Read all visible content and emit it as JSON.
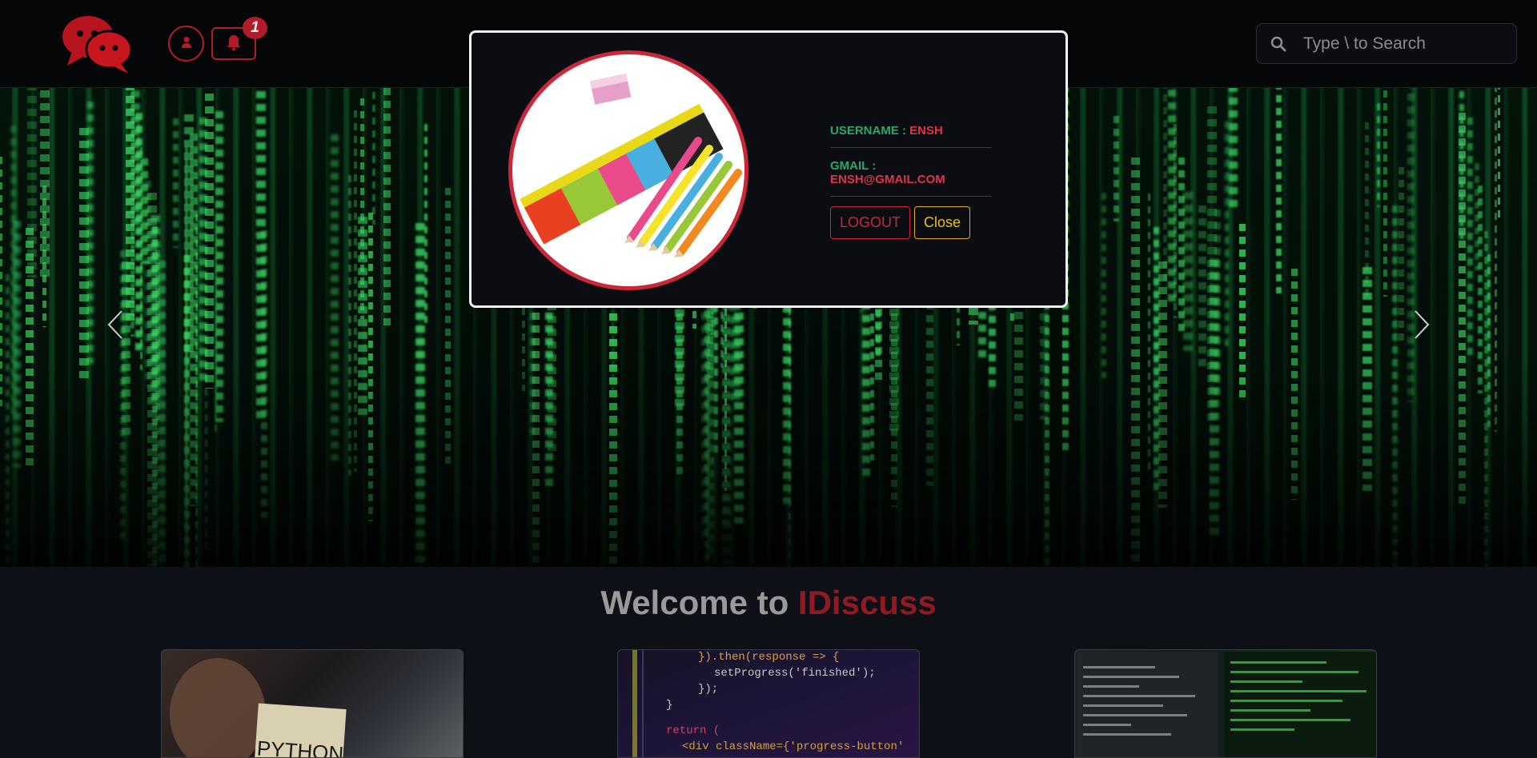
{
  "navbar": {
    "notification_count": "1",
    "search_placeholder": "Type \\ to Search"
  },
  "modal": {
    "username_label": "USERNAME : ",
    "username_value": "ENSH",
    "gmail_label": "GMAIL : ",
    "gmail_value": "ENSH@GMAIL.COM",
    "logout_label": "LOGOUT",
    "close_label": "Close"
  },
  "welcome": {
    "prefix": "Welcome to ",
    "brand": "IDiscuss"
  },
  "colors": {
    "accent": "#b01c2a",
    "success_text": "#2aa86a",
    "danger_text": "#e0344a",
    "warning": "#e0b020"
  },
  "icons": {
    "logo": "chat-bubbles-icon",
    "user": "user-icon",
    "bell": "bell-icon",
    "search": "search-icon",
    "prev": "chevron-left-icon",
    "next": "chevron-right-icon"
  }
}
